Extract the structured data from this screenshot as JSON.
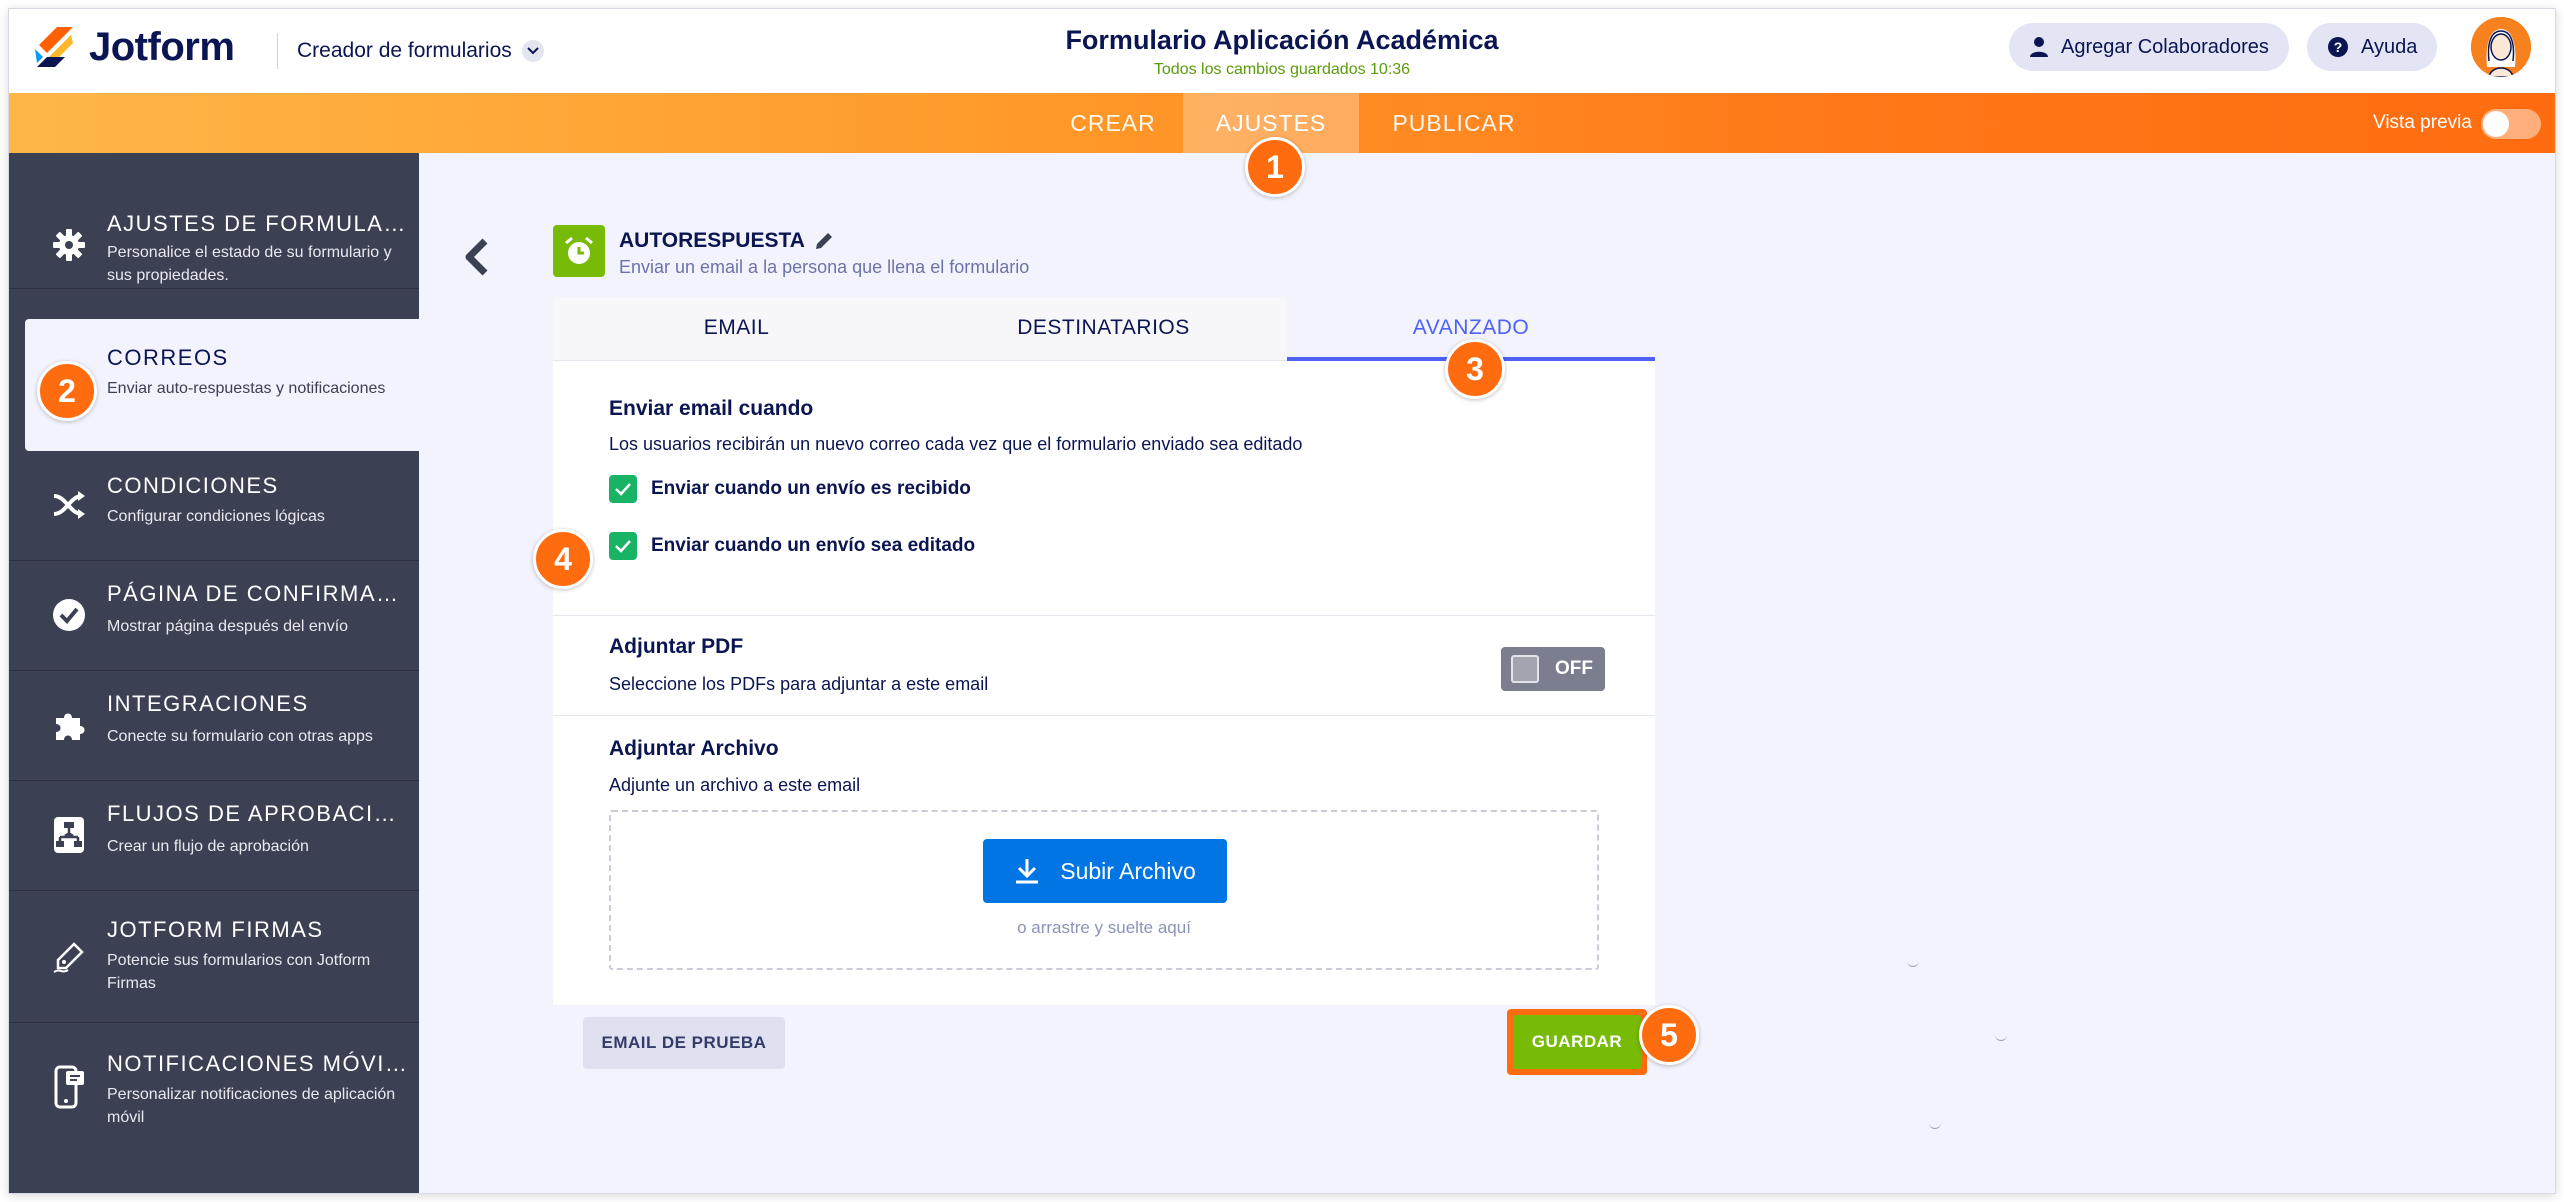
{
  "topbar": {
    "brand": "Jotform",
    "builder_label": "Creador de formularios",
    "form_title": "Formulario Aplicación Académica",
    "saved_status": "Todos los cambios guardados 10:36",
    "collaborators_label": "Agregar Colaboradores",
    "help_label": "Ayuda"
  },
  "nav": {
    "tabs": [
      {
        "label": "CREAR"
      },
      {
        "label": "AJUSTES"
      },
      {
        "label": "PUBLICAR"
      }
    ],
    "preview_label": "Vista previa"
  },
  "sidebar": {
    "items": [
      {
        "title": "AJUSTES DE FORMULARIO",
        "desc": "Personalice el estado de su formulario y sus propiedades."
      },
      {
        "title": "CORREOS",
        "desc": "Enviar auto-respuestas y notificaciones"
      },
      {
        "title": "CONDICIONES",
        "desc": "Configurar condiciones lógicas"
      },
      {
        "title": "PÁGINA DE CONFIRMACIÓN",
        "desc": "Mostrar página después del envío"
      },
      {
        "title": "INTEGRACIONES",
        "desc": "Conecte su formulario con otras apps"
      },
      {
        "title": "FLUJOS DE APROBACIÓN",
        "desc": "Crear un flujo de aprobación"
      },
      {
        "title": "JOTFORM FIRMAS",
        "desc": "Potencie sus formularios con Jotform Firmas"
      },
      {
        "title": "NOTIFICACIONES MÓVILES",
        "desc": "Personalizar notificaciones de aplicación móvil"
      }
    ]
  },
  "autoresponse": {
    "title": "AUTORESPUESTA",
    "subtitle": "Enviar un email a la persona que llena el formulario"
  },
  "tabs": [
    {
      "label": "EMAIL"
    },
    {
      "label": "DESTINATARIOS"
    },
    {
      "label": "AVANZADO"
    }
  ],
  "send_when": {
    "title": "Enviar email cuando",
    "desc": "Los usuarios recibirán un nuevo correo cada vez que el formulario enviado sea editado",
    "options": [
      {
        "label": "Enviar cuando un envío es recibido",
        "checked": true
      },
      {
        "label": "Enviar cuando un envío sea editado",
        "checked": true
      }
    ]
  },
  "attach_pdf": {
    "title": "Adjuntar PDF",
    "desc": "Seleccione los PDFs para adjuntar a este email",
    "toggle_label": "OFF"
  },
  "attach_file": {
    "title": "Adjuntar Archivo",
    "desc": "Adjunte un archivo a este email",
    "upload_label": "Subir Archivo",
    "drop_hint": "o arrastre y suelte aquí"
  },
  "footer": {
    "test_label": "EMAIL DE PRUEBA",
    "save_label": "GUARDAR"
  },
  "badges": [
    "1",
    "2",
    "3",
    "4",
    "5"
  ],
  "colors": {
    "accent_orange": "#ff6c10",
    "green": "#78bb07",
    "blue": "#0075e3",
    "sidebar_bg": "#3b4053"
  }
}
